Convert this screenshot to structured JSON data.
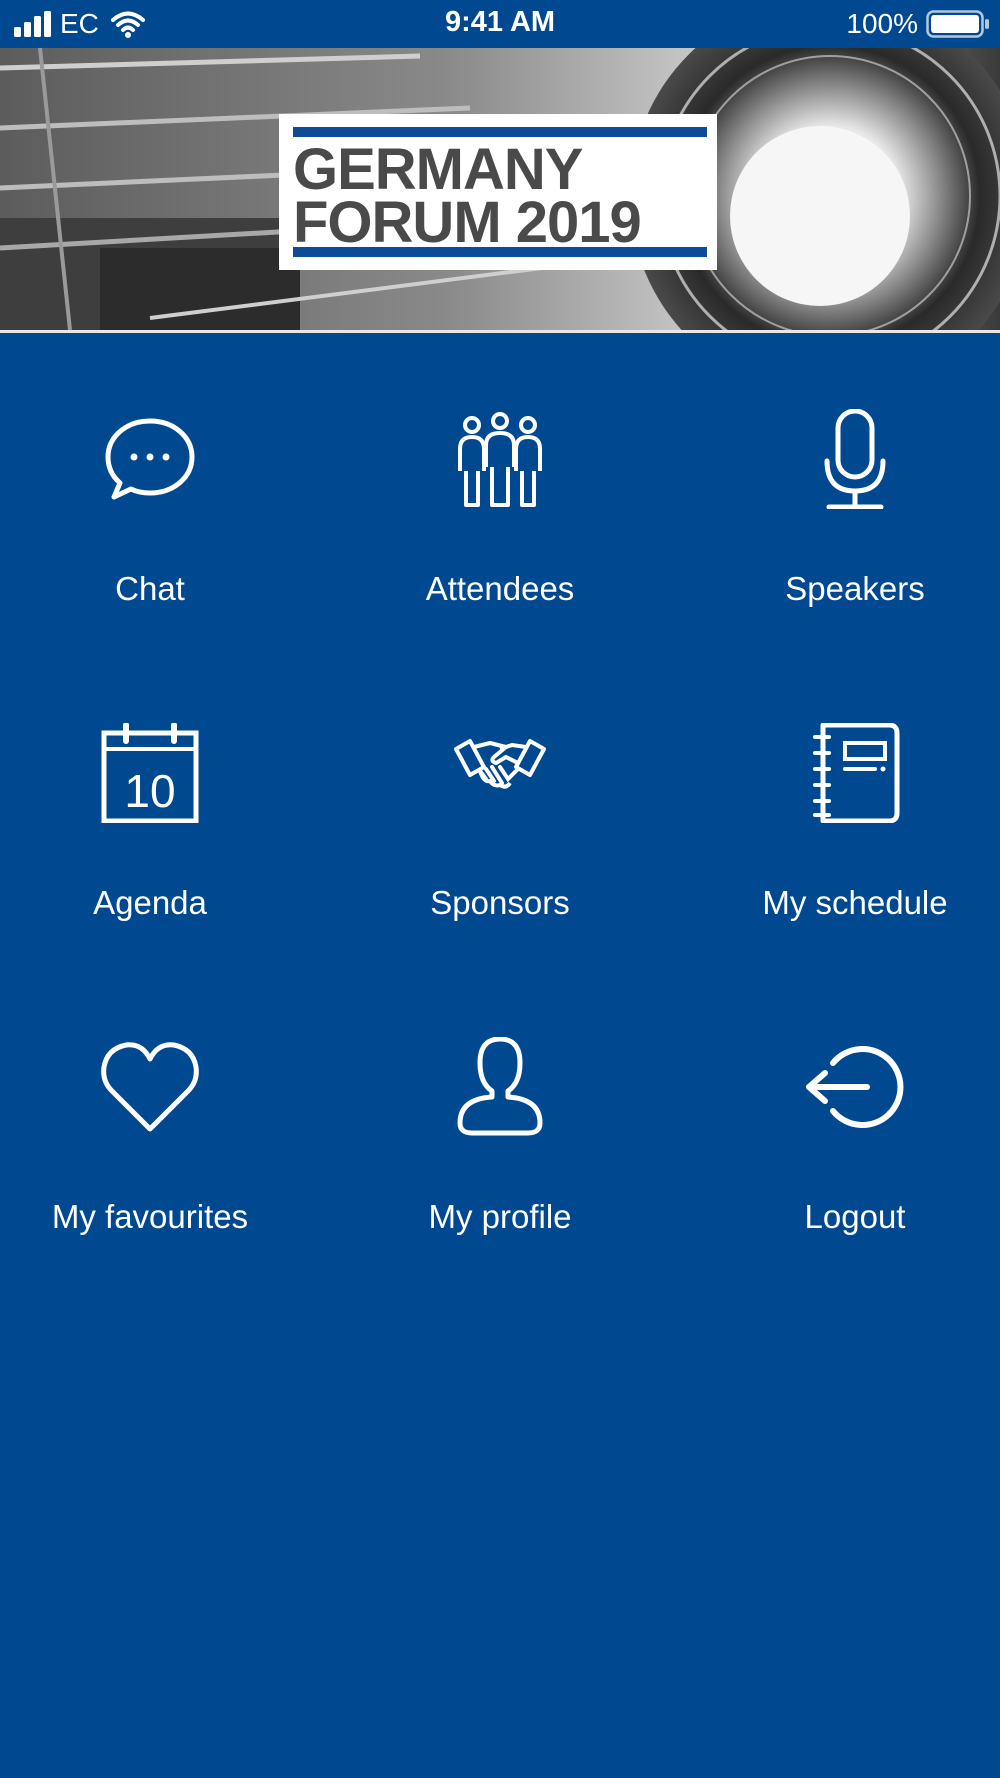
{
  "status_bar": {
    "carrier": "EC",
    "time": "9:41 AM",
    "battery": "100%"
  },
  "banner": {
    "logo_line_1": "GERMANY",
    "logo_line_2": "FORUM 2019",
    "logo_rule_color": "#0d4a97"
  },
  "theme": {
    "background": "#004990",
    "foreground": "#ffffff"
  },
  "menu": [
    {
      "label": "Chat",
      "icon": "chat-bubble-icon"
    },
    {
      "label": "Attendees",
      "icon": "people-group-icon"
    },
    {
      "label": "Speakers",
      "icon": "microphone-icon"
    },
    {
      "label": "Agenda",
      "icon": "calendar-icon",
      "icon_text": "10"
    },
    {
      "label": "Sponsors",
      "icon": "handshake-icon"
    },
    {
      "label": "My schedule",
      "icon": "notebook-icon"
    },
    {
      "label": "My favourites",
      "icon": "heart-icon"
    },
    {
      "label": "My profile",
      "icon": "user-icon"
    },
    {
      "label": "Logout",
      "icon": "logout-icon"
    }
  ]
}
